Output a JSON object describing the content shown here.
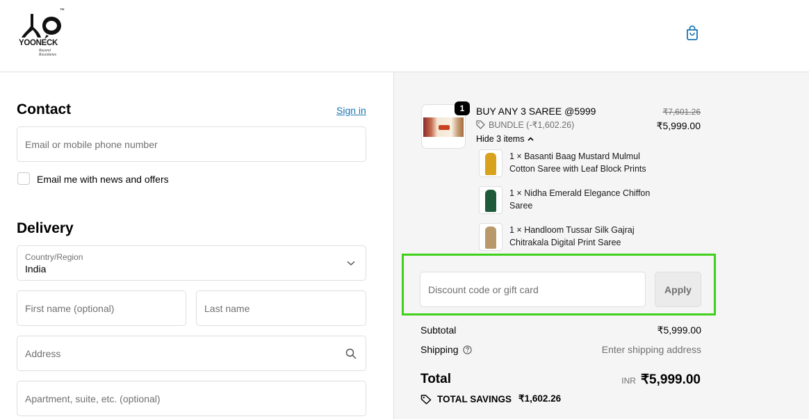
{
  "header": {
    "brand": "YOONECK",
    "tm": "™",
    "tagline": "Beyond Boundaries",
    "cart_icon": "shopping-bag-icon"
  },
  "contact": {
    "heading": "Contact",
    "sign_in_label": "Sign in",
    "email_placeholder": "Email or mobile phone number",
    "newsletter_label": "Email me with news and offers"
  },
  "delivery": {
    "heading": "Delivery",
    "country_label": "Country/Region",
    "country_value": "India",
    "first_name_placeholder": "First name (optional)",
    "last_name_placeholder": "Last name",
    "address_placeholder": "Address",
    "apartment_placeholder": "Apartment, suite, etc. (optional)"
  },
  "order": {
    "quantity": "1",
    "product_title": "BUY ANY 3 SAREE @5999",
    "bundle_label": "BUNDLE (-₹1,602.26)",
    "hide_items_label": "Hide 3 items",
    "price_original": "₹7,601.26",
    "price_final": "₹5,999.00",
    "items": [
      {
        "text": "1 × Basanti Baag Mustard Mulmul Cotton Saree with Leaf Block Prints",
        "color": "#d9a21c"
      },
      {
        "text": "1 × Nidha Emerald Elegance Chiffon Saree",
        "color": "#1f5a3a"
      },
      {
        "text": "1 × Handloom Tussar Silk Gajraj Chitrakala Digital Print Saree",
        "color": "#b89a6a"
      }
    ]
  },
  "discount": {
    "placeholder": "Discount code or gift card",
    "apply_label": "Apply",
    "highlight_color": "#3fd11a"
  },
  "summary": {
    "subtotal_label": "Subtotal",
    "subtotal_value": "₹5,999.00",
    "shipping_label": "Shipping",
    "shipping_value": "Enter shipping address",
    "total_label": "Total",
    "currency": "INR",
    "total_value": "₹5,999.00",
    "savings_label": "TOTAL SAVINGS",
    "savings_value": "₹1,602.26"
  },
  "colors": {
    "link": "#1773b0",
    "muted": "#707070",
    "panel_bg": "#f5f5f5"
  }
}
